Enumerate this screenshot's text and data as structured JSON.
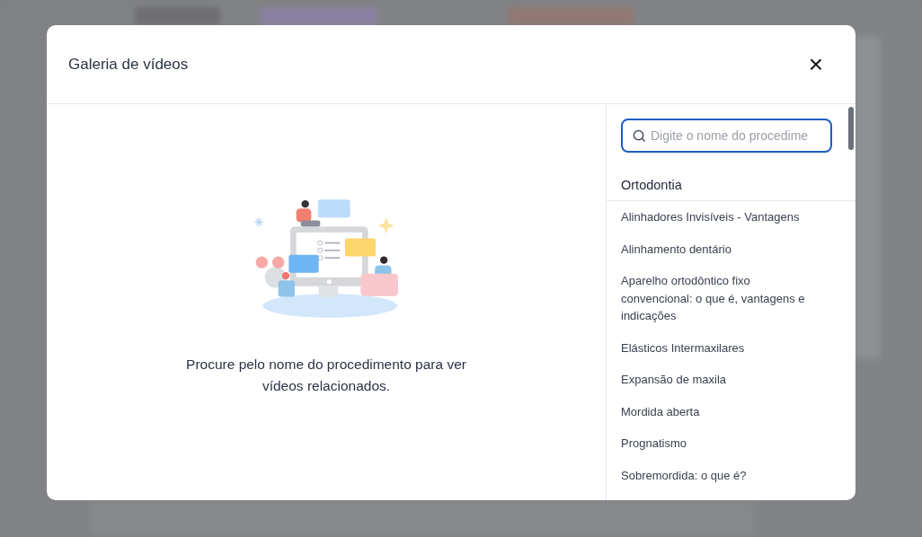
{
  "dialog": {
    "title": "Galeria de vídeos",
    "close_label": "×"
  },
  "empty_state": {
    "message": "Procure pelo nome do procedimento para ver vídeos relacionados."
  },
  "search": {
    "placeholder": "Digite o nome do procedime"
  },
  "category": {
    "name": "Ortodontia",
    "items": [
      "Alinhadores Invisíveis - Vantagens",
      "Alinhamento dentário",
      "Aparelho ortodôntico fixo convencional: o que é, vantagens e indicações",
      "Elásticos Intermaxilares",
      "Expansão de maxila",
      "Mordida aberta",
      "Prognatismo",
      "Sobremordida: o que é?"
    ]
  }
}
